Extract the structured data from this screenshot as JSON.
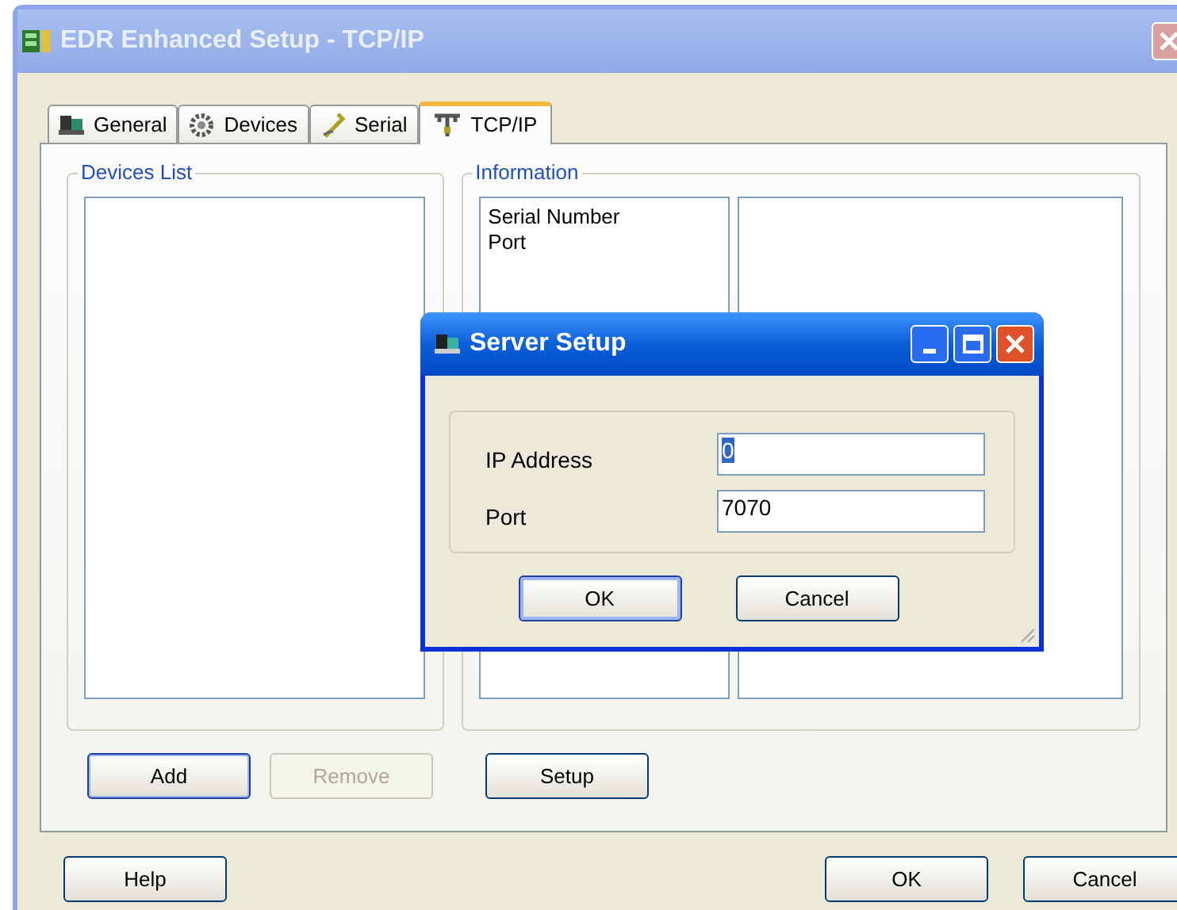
{
  "window": {
    "title": "EDR Enhanced Setup - TCP/IP"
  },
  "tabs": [
    {
      "label": "General",
      "kind": "computer",
      "selected": false
    },
    {
      "label": "Devices",
      "kind": "gear",
      "selected": false
    },
    {
      "label": "Serial",
      "kind": "cable",
      "selected": false
    },
    {
      "label": "TCP/IP",
      "kind": "network",
      "selected": true
    }
  ],
  "devices_group": {
    "title": "Devices List",
    "buttons": [
      {
        "label": "Add",
        "disabled": false,
        "default": true
      },
      {
        "label": "Remove",
        "disabled": true,
        "default": false
      }
    ]
  },
  "information_group": {
    "title": "Information",
    "fields": [
      "Serial Number",
      "Port"
    ],
    "button": {
      "label": "Setup"
    }
  },
  "bottom_buttons": [
    {
      "label": "Help"
    },
    {
      "label": "OK"
    },
    {
      "label": "Cancel"
    }
  ],
  "dialog": {
    "title": "Server Setup",
    "rows": [
      {
        "label": "IP Address",
        "value": "0",
        "value_selected": true
      },
      {
        "label": "Port",
        "value": "7070",
        "value_selected": false
      }
    ],
    "buttons": [
      {
        "label": "OK",
        "default": true
      },
      {
        "label": "Cancel",
        "default": false
      }
    ]
  }
}
